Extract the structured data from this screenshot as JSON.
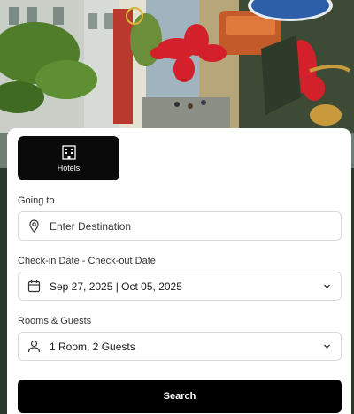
{
  "tabs": [
    {
      "label": "Hotels",
      "icon": "building-icon",
      "selected": true
    }
  ],
  "destination": {
    "label": "Going to",
    "placeholder": "Enter Destination",
    "icon": "location-pin-icon"
  },
  "dates": {
    "label": "Check-in Date - Check-out Date",
    "value": "Sep 27, 2025 | Oct 05, 2025",
    "icon": "calendar-icon"
  },
  "guests": {
    "label": "Rooms & Guests",
    "value": "1 Room, 2 Guests",
    "icon": "person-icon"
  },
  "search_label": "Search",
  "colors": {
    "primary": "#000000",
    "field_border": "#d9d9d9",
    "hero_flowers": "#d4202a"
  }
}
